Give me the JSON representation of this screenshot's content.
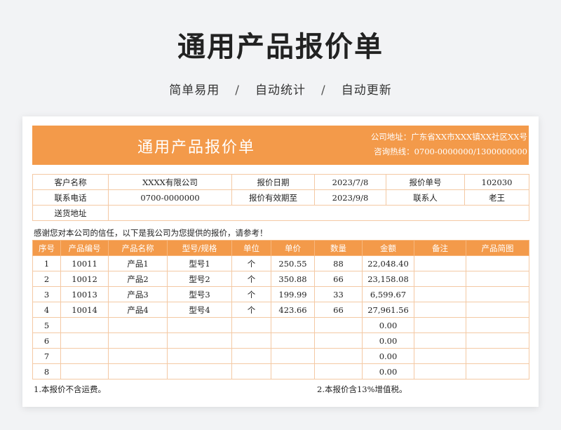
{
  "page": {
    "title": "通用产品报价单",
    "taglines": [
      "简单易用",
      "自动统计",
      "自动更新"
    ],
    "separator": "/"
  },
  "sheet": {
    "banner_title": "通用产品报价单",
    "company_address": "公司地址：广东省XX市XXX镇XX社区XX号",
    "hotline": "咨询热线：0700-0000000/1300000000"
  },
  "info": {
    "customer_label": "客户名称",
    "customer_value": "XXXX有限公司",
    "date_label": "报价日期",
    "date_value": "2023/7/8",
    "quote_no_label": "报价单号",
    "quote_no_value": "102030",
    "phone_label": "联系电话",
    "phone_value": "0700-0000000",
    "valid_label": "报价有效期至",
    "valid_value": "2023/9/8",
    "contact_label": "联系人",
    "contact_value": "老王",
    "address_label": "送货地址",
    "address_value": ""
  },
  "thanks": "感谢您对本公司的信任，以下是我公司为您提供的报价，请参考！",
  "items": {
    "headers": [
      "序号",
      "产品编号",
      "产品名称",
      "型号/规格",
      "单位",
      "单价",
      "数量",
      "金额",
      "备注",
      "产品简图"
    ],
    "rows": [
      [
        "1",
        "10011",
        "产品1",
        "型号1",
        "个",
        "250.55",
        "88",
        "22,048.40",
        "",
        ""
      ],
      [
        "2",
        "10012",
        "产品2",
        "型号2",
        "个",
        "350.88",
        "66",
        "23,158.08",
        "",
        ""
      ],
      [
        "3",
        "10013",
        "产品3",
        "型号3",
        "个",
        "199.99",
        "33",
        "6,599.67",
        "",
        ""
      ],
      [
        "4",
        "10014",
        "产品4",
        "型号4",
        "个",
        "423.66",
        "66",
        "27,961.56",
        "",
        ""
      ],
      [
        "5",
        "",
        "",
        "",
        "",
        "",
        "",
        "0.00",
        "",
        ""
      ],
      [
        "6",
        "",
        "",
        "",
        "",
        "",
        "",
        "0.00",
        "",
        ""
      ],
      [
        "7",
        "",
        "",
        "",
        "",
        "",
        "",
        "0.00",
        "",
        ""
      ],
      [
        "8",
        "",
        "",
        "",
        "",
        "",
        "",
        "0.00",
        "",
        ""
      ]
    ]
  },
  "notes": [
    "1.本报价不含运费。",
    "2.本报价含13%增值税。"
  ],
  "colors": {
    "accent": "#f39a4a",
    "border": "#f4c9a4",
    "background": "#f2f3f5"
  }
}
